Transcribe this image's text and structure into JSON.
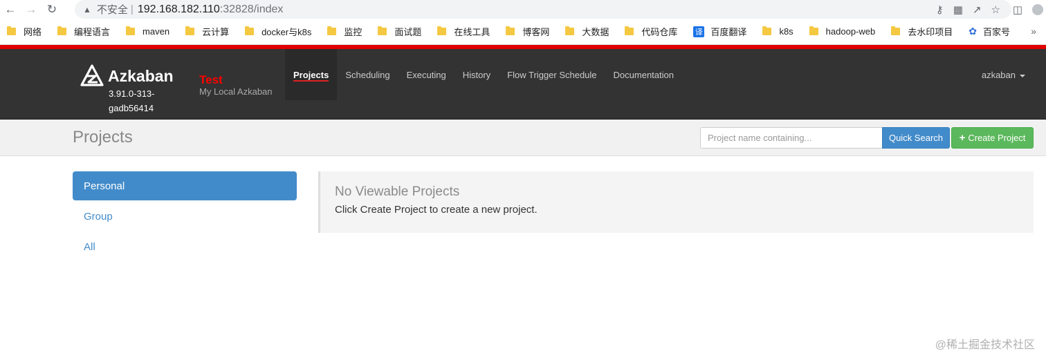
{
  "browser": {
    "warning_text": "不安全",
    "url_host": "192.168.182.110",
    "url_rest": ":32828/index",
    "bookmarks": [
      "网络",
      "编程语言",
      "maven",
      "云计算",
      "docker与k8s",
      "监控",
      "面试题",
      "在线工具",
      "博客网",
      "大数据",
      "代码仓库",
      "百度翻译",
      "k8s",
      "hadoop-web",
      "去水印项目",
      "百家号"
    ],
    "translate_badge": "译",
    "more": "»"
  },
  "app": {
    "brand": "Azkaban",
    "version": "3.91.0-313-gadb56414",
    "env_name": "Test",
    "env_desc": "My Local Azkaban",
    "nav": [
      "Projects",
      "Scheduling",
      "Executing",
      "History",
      "Flow Trigger Schedule",
      "Documentation"
    ],
    "active_nav": "Projects",
    "user": "azkaban",
    "accent_color": "#e00000",
    "primary_color": "#428bca",
    "success_color": "#5cb85c"
  },
  "header": {
    "title": "Projects",
    "search_placeholder": "Project name containing...",
    "quick_search": "Quick Search",
    "create_project": "Create Project"
  },
  "sidebar": {
    "items": [
      "Personal",
      "Group",
      "All"
    ],
    "active": "Personal"
  },
  "panel": {
    "title": "No Viewable Projects",
    "text": "Click Create Project to create a new project."
  },
  "watermark": "@稀土掘金技术社区"
}
